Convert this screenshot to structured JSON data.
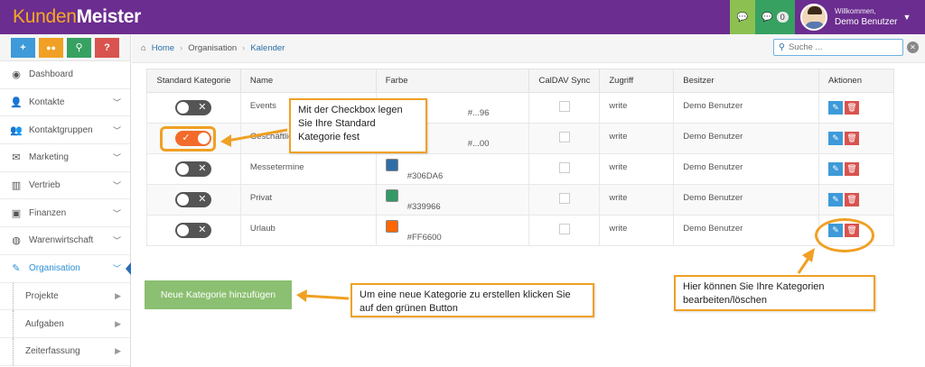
{
  "brand": {
    "part1": "Kunden",
    "part2": "Meister"
  },
  "topbar": {
    "message_badge": "0",
    "welcome_line": "Willkommen,",
    "user_name": "Demo Benutzer"
  },
  "sidebar": {
    "tools": [
      "+",
      "💬",
      "🔍",
      "?"
    ],
    "items": [
      {
        "label": "Dashboard",
        "icon": "palette-icon"
      },
      {
        "label": "Kontakte",
        "icon": "user-icon"
      },
      {
        "label": "Kontaktgruppen",
        "icon": "users-icon"
      },
      {
        "label": "Marketing",
        "icon": "envelope-icon"
      },
      {
        "label": "Vertrieb",
        "icon": "bar-chart-icon"
      },
      {
        "label": "Finanzen",
        "icon": "money-icon"
      },
      {
        "label": "Warenwirtschaft",
        "icon": "globe-icon"
      },
      {
        "label": "Organisation",
        "icon": "edit-icon"
      }
    ],
    "subitems": [
      "Projekte",
      "Aufgaben",
      "Zeiterfassung"
    ]
  },
  "breadcrumb": {
    "home": "Home",
    "section": "Organisation",
    "current": "Kalender"
  },
  "search": {
    "placeholder": "Suche ..."
  },
  "table": {
    "headers": [
      "Standard Kategorie",
      "Name",
      "Farbe",
      "CalDAV Sync",
      "Zugriff",
      "Besitzer",
      "Aktionen"
    ],
    "rows": [
      {
        "name": "Events",
        "color_hex": "#...96",
        "color": "",
        "access": "write",
        "owner": "Demo Benutzer",
        "default": false
      },
      {
        "name": "Geschäftlich",
        "color_hex": "#...00",
        "color": "",
        "access": "write",
        "owner": "Demo Benutzer",
        "default": true
      },
      {
        "name": "Messetermine",
        "color_hex": "#306DA6",
        "color": "#306DA6",
        "access": "write",
        "owner": "Demo Benutzer",
        "default": false
      },
      {
        "name": "Privat",
        "color_hex": "#339966",
        "color": "#339966",
        "access": "write",
        "owner": "Demo Benutzer",
        "default": false
      },
      {
        "name": "Urlaub",
        "color_hex": "#FF6600",
        "color": "#FF6600",
        "access": "write",
        "owner": "Demo Benutzer",
        "default": false
      }
    ]
  },
  "add_button": "Neue Kategorie hinzufügen",
  "callouts": {
    "checkbox": "Mit der Checkbox legen Sie Ihre Standard Kategorie fest",
    "add": "Um eine neue Kategorie zu erstellen klicken Sie auf den grünen Button",
    "edit": "Hier können Sie Ihre Kategorien bearbeiten/löschen"
  },
  "colors": {
    "topbar": "#6b2d8f",
    "logo_accent": "#f7a823",
    "callout_border": "#f0a024",
    "add_button": "#8bbf71",
    "toggle_on": "#f26b2a"
  }
}
